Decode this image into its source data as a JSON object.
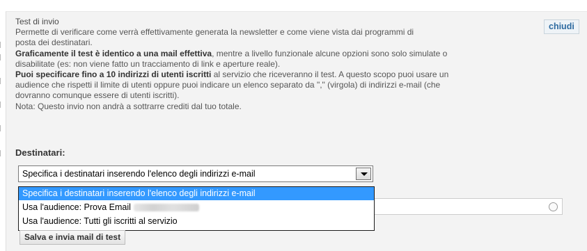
{
  "panel": {
    "title": "Test di invio",
    "close_label": "chiudi",
    "desc_line1": "Permette di verificare come verrà effettivamente generata la newsletter e come viene vista dai programmi di",
    "desc_line2": "posta dei destinatari.",
    "bold1": "Graficamente il test è identico a una mail effettiva",
    "desc_line3_rest": ", mentre a livello funzionale alcune opzioni sono solo simulate o",
    "desc_line4": "disabilitate (es: non viene fatto un tracciamento di link e aperture reale).",
    "bold2": "Puoi specificare fino a 10 indirizzi di utenti iscritti",
    "desc_line5_rest": " al servizio che riceveranno il test. A questo scopo puoi usare un",
    "desc_line6": "audience che rispetti il limite di utenti oppure puoi indicare un elenco separato da \",\" (virgola) di indirizzi e-mail (che",
    "desc_line7": "dovranno comunque essere di utenti iscritti).",
    "note": "Nota: Questo invio non andrà a sottrarre crediti dal tuo totale."
  },
  "recipients": {
    "label": "Destinatari:",
    "selected": "Specifica i destinatari inserendo l'elenco degli indirizzi e-mail",
    "options": [
      "Specifica i destinatari inserendo l'elenco degli indirizzi e-mail",
      "Usa l'audience: Prova Email",
      "Usa l'audience: Tutti gli iscritti al servizio"
    ]
  },
  "actions": {
    "submit_label": "Salva e invia mail di test"
  },
  "colors": {
    "highlight": "#3399ff",
    "link": "#2d6aa0",
    "panel_bg": "#f3f3f3"
  }
}
